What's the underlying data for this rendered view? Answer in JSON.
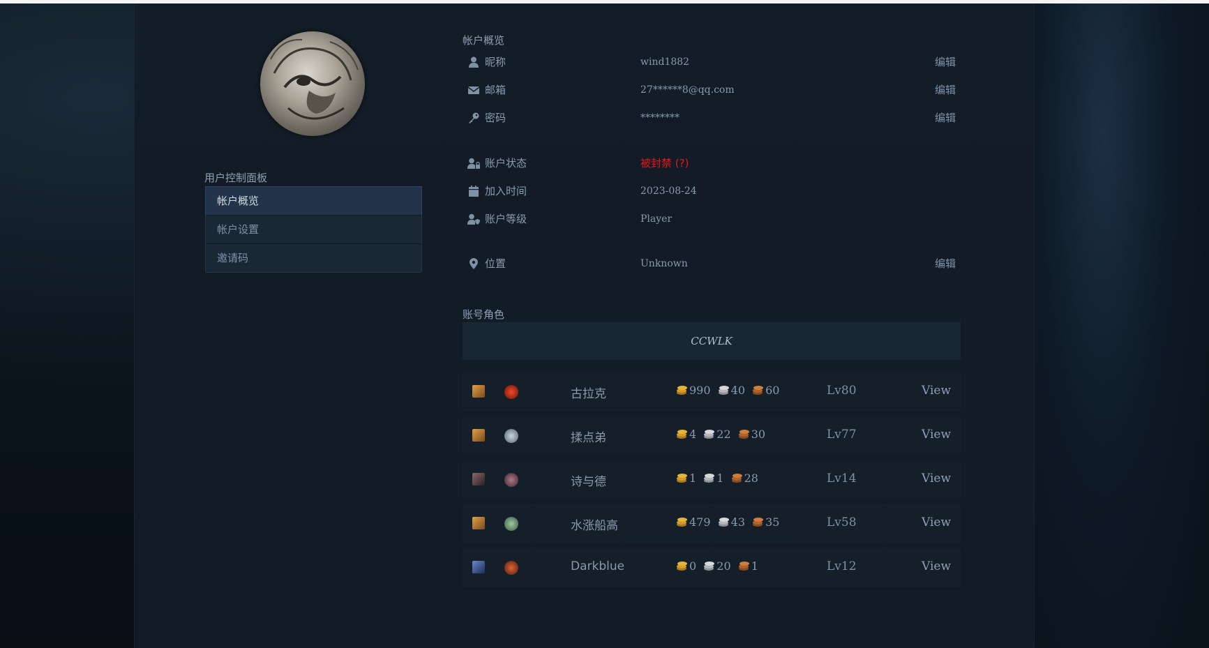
{
  "sidebar": {
    "title": "用户控制面板",
    "items": [
      {
        "label": "帐户概览",
        "active": true
      },
      {
        "label": "帐户设置",
        "active": false
      },
      {
        "label": "邀请码",
        "active": false
      }
    ]
  },
  "overview": {
    "title": "帐户概览",
    "nickname": {
      "icon": "user-icon",
      "label": "昵称",
      "value": "wind1882",
      "edit": "编辑"
    },
    "email": {
      "icon": "envelope-icon",
      "label": "邮箱",
      "value": "27******8@qq.com",
      "edit": "编辑"
    },
    "password": {
      "icon": "key-icon",
      "label": "密码",
      "value": "********",
      "edit": "编辑"
    },
    "status": {
      "icon": "user-lock-icon",
      "label": "账户状态",
      "value": "被封禁 (?)",
      "color": "#e41818"
    },
    "joined": {
      "icon": "calendar-icon",
      "label": "加入时间",
      "value": "2023-08-24"
    },
    "level": {
      "icon": "user-shield-icon",
      "label": "账户等级",
      "value": "Player"
    },
    "location": {
      "icon": "map-pin-icon",
      "label": "位置",
      "value": "Unknown",
      "edit": "编辑"
    }
  },
  "characters": {
    "title": "账号角色",
    "realm": "CCWLK",
    "view_label": "View",
    "list": [
      {
        "race_icon": "race-portrait-icon",
        "class_icon": "class-emblem-icon",
        "name": "古拉克",
        "gold": "990",
        "silver": "40",
        "copper": "60",
        "level": "Lv80"
      },
      {
        "race_icon": "race-portrait-icon",
        "class_icon": "class-emblem-icon",
        "name": "揉点弟",
        "gold": "4",
        "silver": "22",
        "copper": "30",
        "level": "Lv77"
      },
      {
        "race_icon": "race-portrait-icon",
        "class_icon": "class-emblem-icon",
        "name": "诗与德",
        "gold": "1",
        "silver": "1",
        "copper": "28",
        "level": "Lv14"
      },
      {
        "race_icon": "race-portrait-icon",
        "class_icon": "class-emblem-icon",
        "name": "水涨船高",
        "gold": "479",
        "silver": "43",
        "copper": "35",
        "level": "Lv58"
      },
      {
        "race_icon": "race-portrait-icon",
        "class_icon": "class-emblem-icon",
        "name": "Darkblue",
        "gold": "0",
        "silver": "20",
        "copper": "1",
        "level": "Lv12"
      }
    ]
  },
  "colors": {
    "gold": "#e7b43a",
    "silver": "#c9ccd0",
    "copper": "#c9783a",
    "accent": "#22334a"
  }
}
